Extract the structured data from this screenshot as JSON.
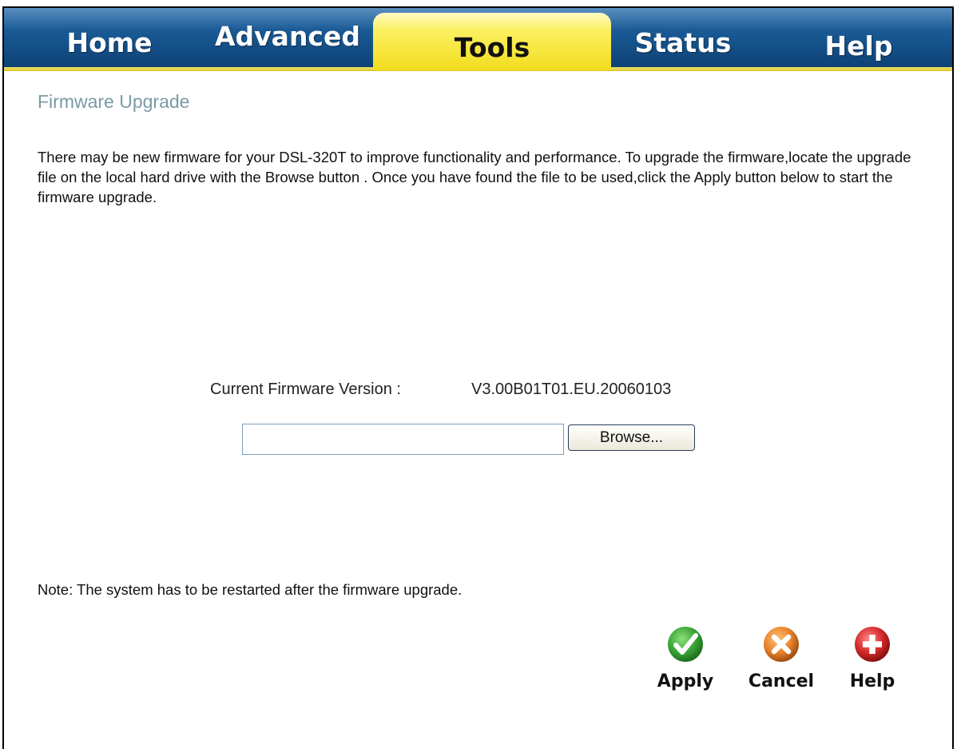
{
  "tabs": [
    {
      "label": "Home",
      "active": false
    },
    {
      "label": "Advanced",
      "active": false
    },
    {
      "label": "Tools",
      "active": true
    },
    {
      "label": "Status",
      "active": false
    },
    {
      "label": "Help",
      "active": false
    }
  ],
  "page": {
    "title": "Firmware Upgrade",
    "intro": "There may be new firmware for your DSL-320T to improve functionality and performance. To upgrade the firmware,locate the upgrade file on the local hard drive with the Browse button . Once you have found the file to be used,click the Apply button below to start the firmware upgrade.",
    "version_label": "Current Firmware Version :",
    "version_value": "V3.00B01T01.EU.20060103",
    "file_input_value": "",
    "browse_label": "Browse...",
    "note": "Note: The system has to be restarted after the firmware upgrade."
  },
  "actions": {
    "apply_label": "Apply",
    "cancel_label": "Cancel",
    "help_label": "Help"
  },
  "colors": {
    "tab_bar": "#1a5b96",
    "active_tab": "#fbf061",
    "title": "#7a9aa6",
    "apply_icon": "#3aa535",
    "cancel_icon": "#e8832a",
    "help_icon": "#d42a2a"
  },
  "icons": {
    "apply": "checkmark-icon",
    "cancel": "x-icon",
    "help": "plus-icon"
  }
}
